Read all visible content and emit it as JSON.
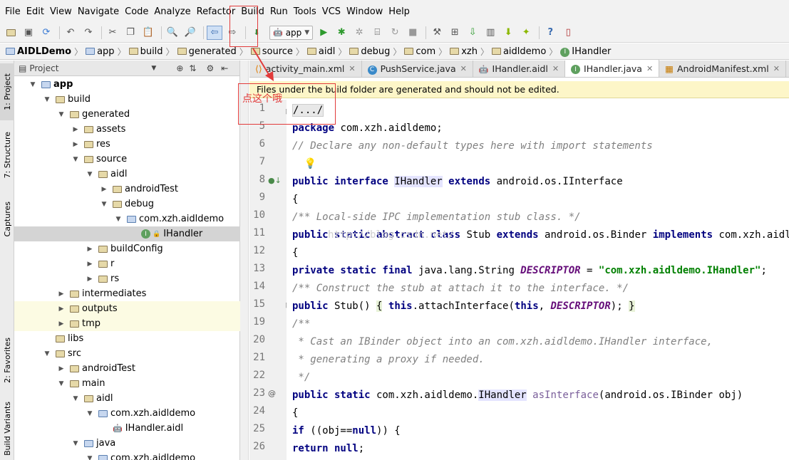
{
  "menubar": {
    "items": [
      "File",
      "Edit",
      "View",
      "Navigate",
      "Code",
      "Analyze",
      "Refactor",
      "Build",
      "Run",
      "Tools",
      "VCS",
      "Window",
      "Help"
    ]
  },
  "toolbar": {
    "icons": [
      "open-icon",
      "save-icon",
      "sync-icon",
      "undo-icon",
      "redo-icon",
      "cut-icon",
      "copy-icon",
      "paste-icon",
      "find-icon",
      "replace-icon",
      "back-icon",
      "forward-icon",
      "make-project-icon"
    ],
    "run_config": "app",
    "run_icons": [
      "run-icon",
      "debug-icon",
      "coverage-icon",
      "attach-icon",
      "rerun-icon",
      "stop-icon",
      "project-structure-icon",
      "sdk-manager-icon",
      "avd-manager-icon",
      "sync-gradle-icon",
      "android-monitor-icon",
      "android-icon",
      "help-icon",
      "device-icon"
    ]
  },
  "breadcrumbs": [
    "AIDLDemo",
    "app",
    "build",
    "generated",
    "source",
    "aidl",
    "debug",
    "com",
    "xzh",
    "aidldemo",
    "IHandler"
  ],
  "left_strip": {
    "project": "1: Project",
    "structure": "7: Structure",
    "captures": "Captures",
    "favorites": "2: Favorites",
    "build_variants": "Build Variants"
  },
  "project_panel": {
    "title": "Project",
    "tree": [
      {
        "label": "app",
        "depth": 0,
        "arrow": "▼",
        "icon": "module",
        "bold": true
      },
      {
        "label": "build",
        "depth": 1,
        "arrow": "▼",
        "icon": "folder"
      },
      {
        "label": "generated",
        "depth": 2,
        "arrow": "▼",
        "icon": "folder"
      },
      {
        "label": "assets",
        "depth": 3,
        "arrow": "▶",
        "icon": "folder"
      },
      {
        "label": "res",
        "depth": 3,
        "arrow": "▶",
        "icon": "folder"
      },
      {
        "label": "source",
        "depth": 3,
        "arrow": "▼",
        "icon": "folder"
      },
      {
        "label": "aidl",
        "depth": 4,
        "arrow": "▼",
        "icon": "folder"
      },
      {
        "label": "androidTest",
        "depth": 5,
        "arrow": "▶",
        "icon": "folder"
      },
      {
        "label": "debug",
        "depth": 5,
        "arrow": "▼",
        "icon": "folder"
      },
      {
        "label": "com.xzh.aidldemo",
        "depth": 6,
        "arrow": "▼",
        "icon": "package"
      },
      {
        "label": "IHandler",
        "depth": 7,
        "arrow": "",
        "icon": "interface",
        "selected": true
      },
      {
        "label": "buildConfig",
        "depth": 4,
        "arrow": "▶",
        "icon": "folder"
      },
      {
        "label": "r",
        "depth": 4,
        "arrow": "▶",
        "icon": "folder"
      },
      {
        "label": "rs",
        "depth": 4,
        "arrow": "▶",
        "icon": "folder"
      },
      {
        "label": "intermediates",
        "depth": 2,
        "arrow": "▶",
        "icon": "folder"
      },
      {
        "label": "outputs",
        "depth": 2,
        "arrow": "▶",
        "icon": "folder",
        "highlight": true
      },
      {
        "label": "tmp",
        "depth": 2,
        "arrow": "▶",
        "icon": "folder",
        "highlight": true
      },
      {
        "label": "libs",
        "depth": 1,
        "arrow": "",
        "icon": "folder"
      },
      {
        "label": "src",
        "depth": 1,
        "arrow": "▼",
        "icon": "folder"
      },
      {
        "label": "androidTest",
        "depth": 2,
        "arrow": "▶",
        "icon": "folder"
      },
      {
        "label": "main",
        "depth": 2,
        "arrow": "▼",
        "icon": "folder"
      },
      {
        "label": "aidl",
        "depth": 3,
        "arrow": "▼",
        "icon": "folder"
      },
      {
        "label": "com.xzh.aidldemo",
        "depth": 4,
        "arrow": "▼",
        "icon": "package"
      },
      {
        "label": "IHandler.aidl",
        "depth": 5,
        "arrow": "",
        "icon": "droid"
      },
      {
        "label": "java",
        "depth": 3,
        "arrow": "▼",
        "icon": "folder-blue"
      },
      {
        "label": "com.xzh.aidldemo",
        "depth": 4,
        "arrow": "▼",
        "icon": "package"
      }
    ]
  },
  "editor_tabs": [
    {
      "label": "activity_main.xml",
      "icon": "xml"
    },
    {
      "label": "PushService.java",
      "icon": "class"
    },
    {
      "label": "IHandler.aidl",
      "icon": "droid"
    },
    {
      "label": "IHandler.java",
      "icon": "interface",
      "active": true
    },
    {
      "label": "AndroidManifest.xml",
      "icon": "manifest"
    }
  ],
  "notice": "Files under the build folder are generated and should not be edited.",
  "annotation": "点这个哦",
  "watermark": "http://blog.csdn.net/",
  "line_numbers": [
    "1",
    "5",
    "6",
    "7",
    "8",
    "9",
    "10",
    "11",
    "12",
    "13",
    "14",
    "15",
    "19",
    "20",
    "21",
    "22",
    "23",
    "24",
    "25",
    "26"
  ]
}
